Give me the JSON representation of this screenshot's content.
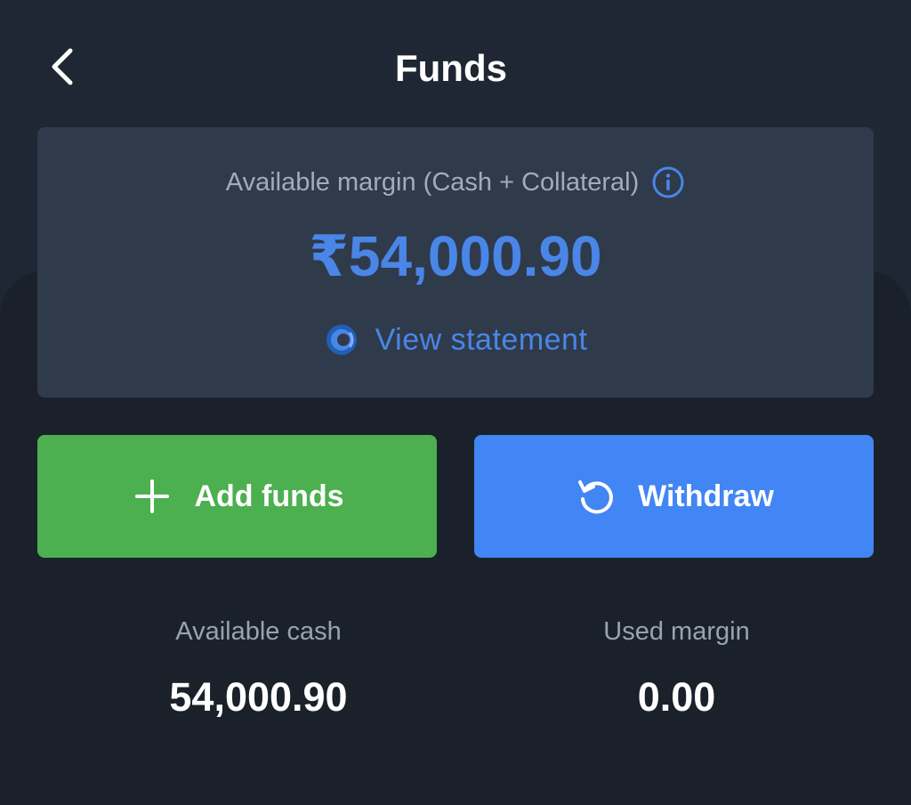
{
  "header": {
    "title": "Funds"
  },
  "margin_card": {
    "label": "Available margin (Cash + Collateral)",
    "value": "₹54,000.90",
    "statement_link": "View statement"
  },
  "actions": {
    "add_funds_label": "Add funds",
    "withdraw_label": "Withdraw"
  },
  "stats": {
    "available_cash_label": "Available cash",
    "available_cash_value": "54,000.90",
    "used_margin_label": "Used margin",
    "used_margin_value": "0.00"
  },
  "icons": {
    "back": "chevron-left-icon",
    "info": "info-icon",
    "statement": "statement-icon",
    "add": "plus-icon",
    "withdraw": "withdraw-icon"
  },
  "colors": {
    "background": "#1e2733",
    "card": "#2f3b4b",
    "accent_blue": "#4a86e8",
    "add_green": "#4caf50",
    "withdraw_blue": "#4285f4",
    "text_white": "#ffffff",
    "text_muted": "#a3acb8"
  }
}
